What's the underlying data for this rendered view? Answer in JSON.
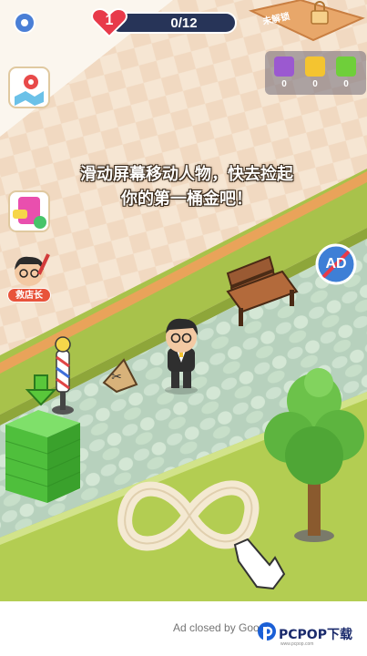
{
  "hud": {
    "level": "1",
    "progress_text": "0/12",
    "locked_label": "未解锁",
    "resources": [
      {
        "name": "purple-ticket",
        "count": "0",
        "color": "#9b59d0"
      },
      {
        "name": "yellow-ticket",
        "count": "0",
        "color": "#f4c430"
      },
      {
        "name": "cash",
        "count": "0",
        "color": "#6fcf3a"
      }
    ]
  },
  "side": {
    "shop_manager_label": "救店长"
  },
  "tutorial": {
    "line1": "滑动屏幕移动人物，快去捡起",
    "line2": "你的第一桶金吧！"
  },
  "ad": {
    "no_ad_label": "AD",
    "closed_by": "Ad closed by Google"
  },
  "watermark": {
    "brand": "PCPOP下载",
    "sub": "www.pcpop.com"
  },
  "colors": {
    "grass": "#a9c44d",
    "path": "#c9dfc0",
    "floor": "#f3e1cc",
    "hud_dark": "#273458",
    "heart": "#e83a4a"
  }
}
